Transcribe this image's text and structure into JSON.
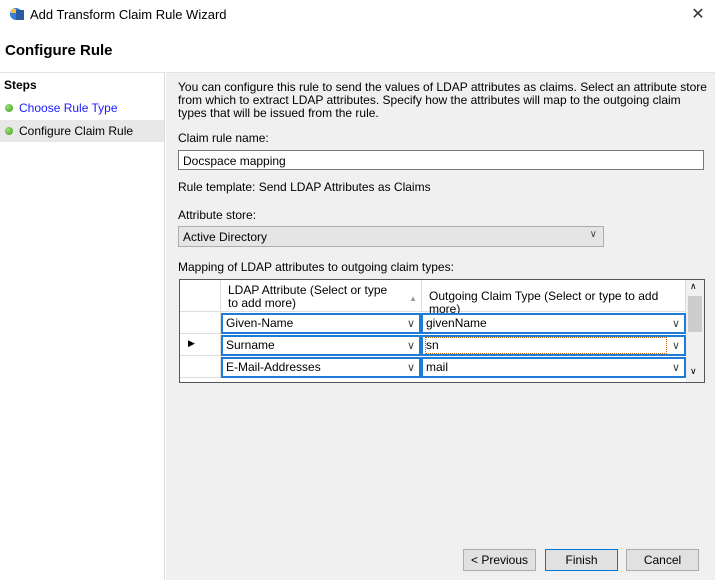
{
  "window": {
    "title": "Add Transform Claim Rule Wizard",
    "close": "✕"
  },
  "page_title": "Configure Rule",
  "steps": {
    "header": "Steps",
    "items": [
      {
        "label": "Choose Rule Type"
      },
      {
        "label": "Configure Claim Rule"
      }
    ]
  },
  "description": "You can configure this rule to send the values of LDAP attributes as claims. Select an attribute store from which to extract LDAP attributes. Specify how the attributes will map to the outgoing claim types that will be issued from the rule.",
  "claim_rule_name": {
    "label": "Claim rule name:",
    "value": "Docspace mapping"
  },
  "rule_template": "Rule template: Send LDAP Attributes as Claims",
  "attribute_store": {
    "label": "Attribute store:",
    "value": "Active Directory"
  },
  "mapping": {
    "label": "Mapping of LDAP attributes to outgoing claim types:",
    "columns": [
      "LDAP Attribute (Select or type to add more)",
      "Outgoing Claim Type (Select or type to add more)"
    ],
    "rows": [
      {
        "ldap": "Given-Name",
        "claim": "givenName"
      },
      {
        "ldap": "Surname",
        "claim": "sn"
      },
      {
        "ldap": "E-Mail-Addresses",
        "claim": "mail"
      }
    ]
  },
  "buttons": {
    "previous": "< Previous",
    "finish": "Finish",
    "cancel": "Cancel"
  }
}
